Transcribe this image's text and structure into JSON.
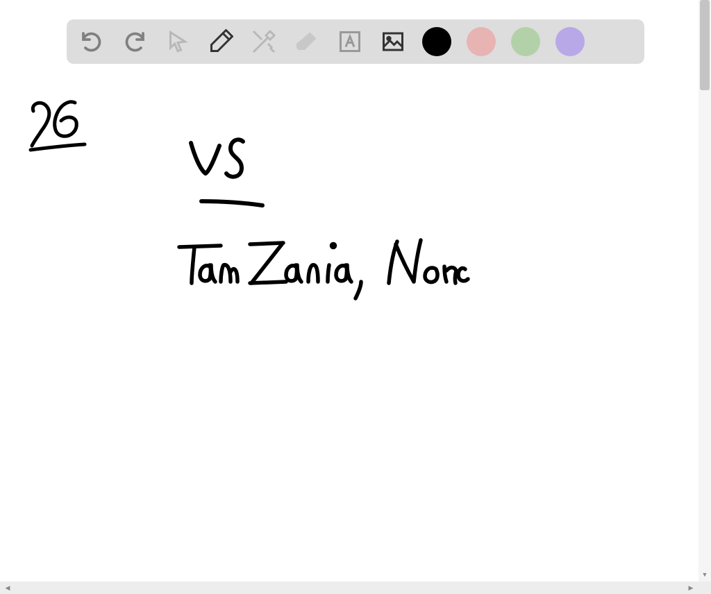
{
  "toolbar": {
    "tools": {
      "undo": "undo",
      "redo": "redo",
      "pointer": "pointer",
      "pen": "pen",
      "tools": "tools",
      "eraser": "eraser",
      "text": "text",
      "image": "image"
    },
    "colors": {
      "black": "#000000",
      "pink": "#e8b3b3",
      "green": "#b3d1a8",
      "purple": "#b8a8e8"
    }
  },
  "canvas": {
    "strokes": [
      {
        "label": "26",
        "underlined": true
      },
      {
        "label": "US",
        "underlined": true
      },
      {
        "label": "Tanzania, Nore"
      }
    ]
  }
}
